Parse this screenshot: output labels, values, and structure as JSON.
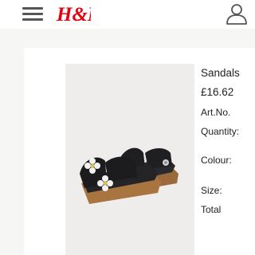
{
  "header": {
    "menu_icon": "hamburger-menu-icon",
    "logo_text": "H&M",
    "account_icon": "user-account-icon",
    "brand_color": "#e50010"
  },
  "product": {
    "name": "Sandals",
    "price": "£16.62",
    "art_no_label": "Art.No.",
    "quantity_label": "Quantity:",
    "colour_label": "Colour:",
    "size_label": "Size:",
    "total_label": "Total"
  }
}
